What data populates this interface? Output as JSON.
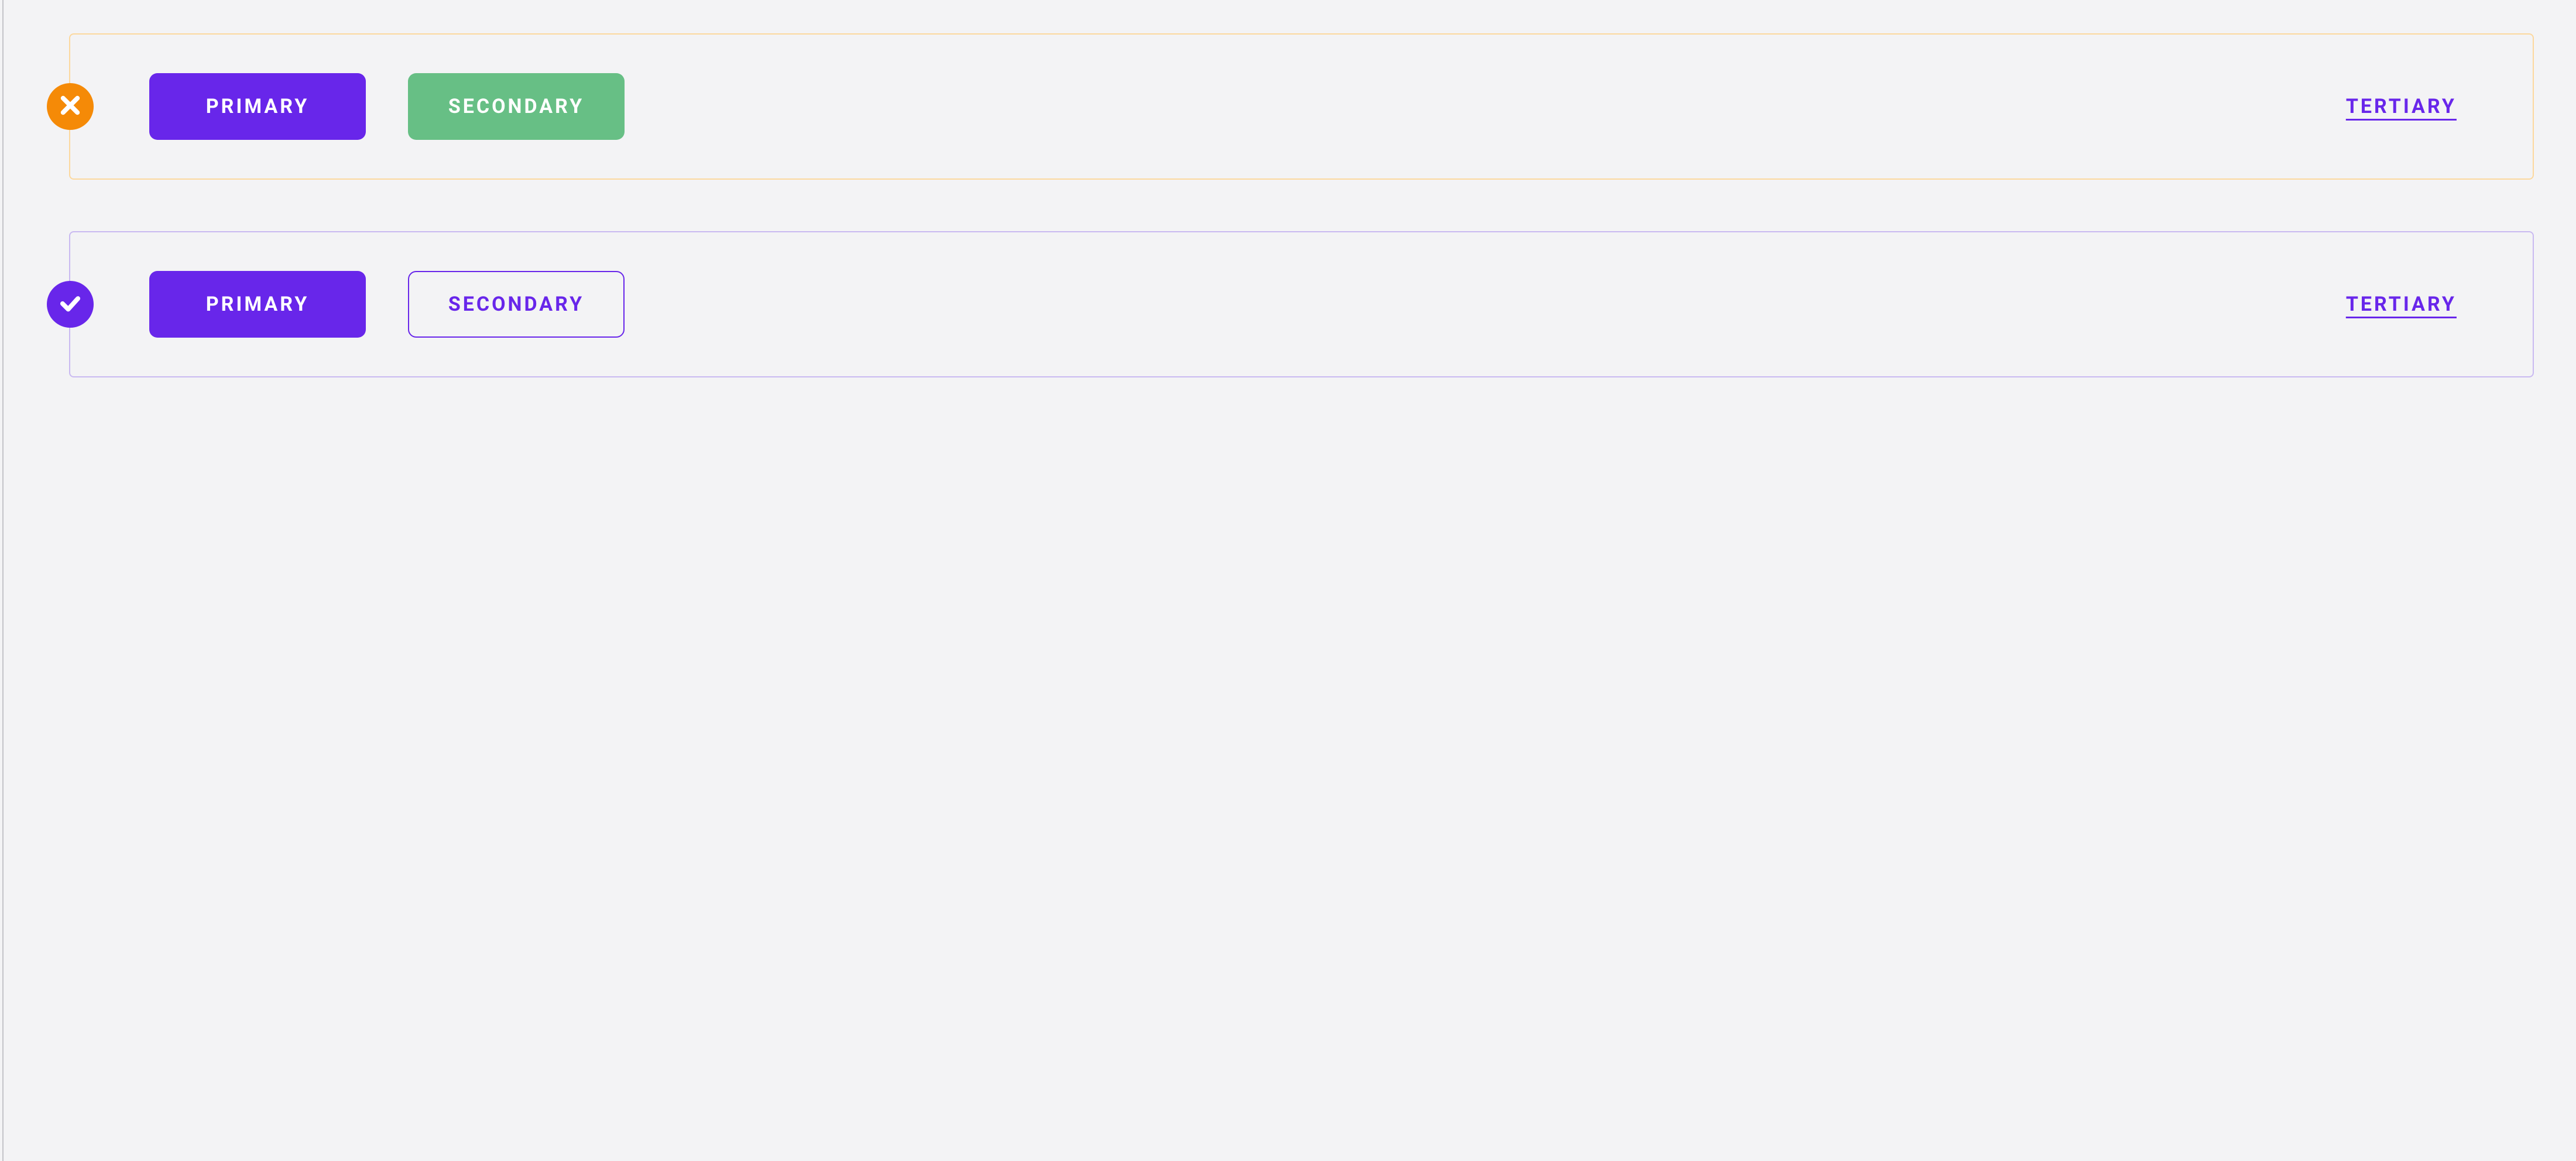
{
  "colors": {
    "purple": "#6826ea",
    "green": "#67bf85",
    "orange": "#f58a07",
    "orange_border": "#fcd89e",
    "purple_border": "#c9b9f1",
    "bg": "#f3f3f5"
  },
  "incorrect": {
    "status": "incorrect",
    "icon": "x-icon",
    "primary_label": "PRIMARY",
    "secondary_label": "SECONDARY",
    "tertiary_label": "TERTIARY"
  },
  "correct": {
    "status": "correct",
    "icon": "check-icon",
    "primary_label": "PRIMARY",
    "secondary_label": "SECONDARY",
    "tertiary_label": "TERTIARY"
  }
}
